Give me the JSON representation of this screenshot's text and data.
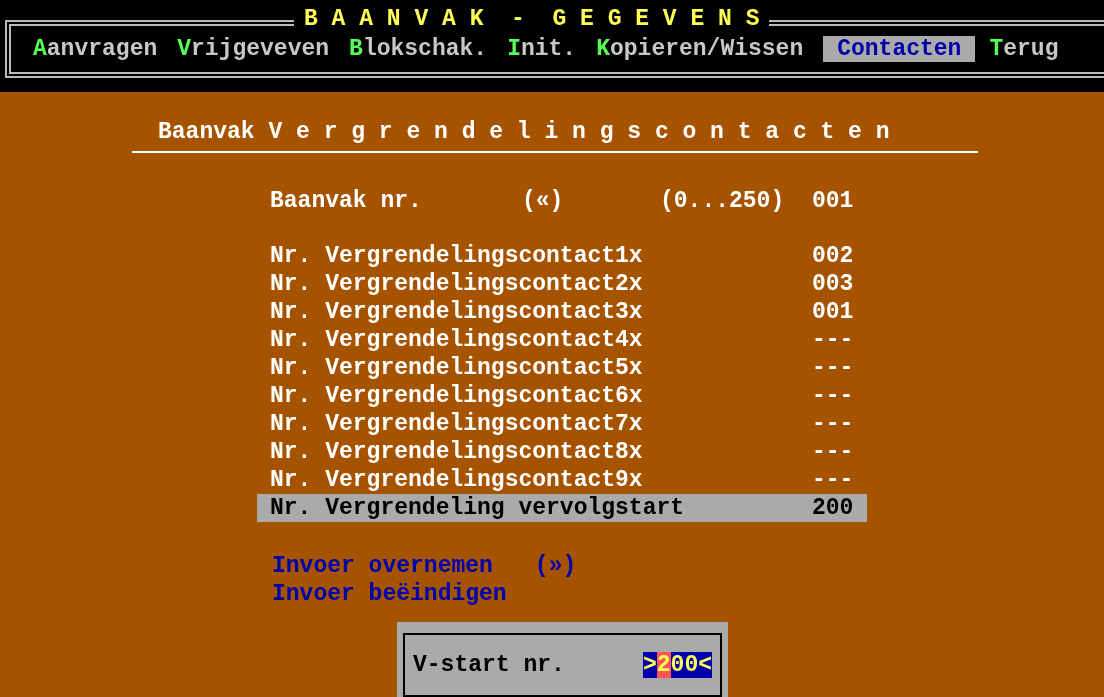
{
  "header": {
    "title": "B A A N V A K  -  G E G E V E N S"
  },
  "menu": [
    {
      "label": "Aanvragen",
      "selected": false
    },
    {
      "label": "Vrijgeveven",
      "selected": false
    },
    {
      "label": "Blokschak.",
      "selected": false
    },
    {
      "label": "Init.",
      "selected": false
    },
    {
      "label": "Kopieren/Wissen",
      "selected": false
    },
    {
      "label": "Contacten",
      "selected": true
    },
    {
      "label": "Terug",
      "selected": false
    }
  ],
  "heading": "Baanvak V e r g r e n d e l i n g s c o n t a c t e n",
  "baanvak": {
    "label": "Baanvak nr.",
    "marker": "(«)",
    "range": "(0...250)",
    "value": "001"
  },
  "rows": [
    {
      "label": "Nr. Vergrendelingscontact1x",
      "value": "002",
      "selected": false
    },
    {
      "label": "Nr. Vergrendelingscontact2x",
      "value": "003",
      "selected": false
    },
    {
      "label": "Nr. Vergrendelingscontact3x",
      "value": "001",
      "selected": false
    },
    {
      "label": "Nr. Vergrendelingscontact4x",
      "value": "---",
      "selected": false
    },
    {
      "label": "Nr. Vergrendelingscontact5x",
      "value": "---",
      "selected": false
    },
    {
      "label": "Nr. Vergrendelingscontact6x",
      "value": "---",
      "selected": false
    },
    {
      "label": "Nr. Vergrendelingscontact7x",
      "value": "---",
      "selected": false
    },
    {
      "label": "Nr. Vergrendelingscontact8x",
      "value": "---",
      "selected": false
    },
    {
      "label": "Nr. Vergrendelingscontact9x",
      "value": "---",
      "selected": false
    },
    {
      "label": "Nr. Vergrendeling vervolgstart",
      "value": "200",
      "selected": true
    }
  ],
  "actions": [
    {
      "label": "Invoer overnemen",
      "marker": "(»)"
    },
    {
      "label": "Invoer beëindigen"
    }
  ],
  "dialog": {
    "label": "V-start nr.",
    "open_mark": ">",
    "value_at_cursor": "2",
    "value_rest": "00",
    "close_mark": "<"
  }
}
